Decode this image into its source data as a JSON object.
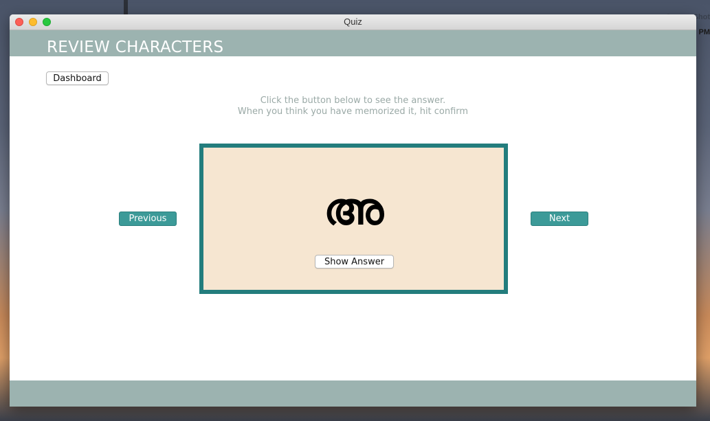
{
  "window": {
    "title": "Quiz"
  },
  "desktop": {
    "overlay_line1": "Screen Shot",
    "overlay_line2": "PM"
  },
  "header": {
    "title": "REVIEW CHARACTERS"
  },
  "toolbar": {
    "dashboard_label": "Dashboard"
  },
  "instructions": {
    "line1": "Click the button below to see the answer.",
    "line2": "When you think you have memorized it, hit confirm"
  },
  "navigation": {
    "previous_label": "Previous",
    "next_label": "Next"
  },
  "card": {
    "character": "അ",
    "show_answer_label": "Show Answer"
  },
  "colors": {
    "accent": "#3c9a98",
    "card_border": "#237d7d",
    "card_background": "#f6e6d1",
    "header_band": "#9cb3b0",
    "instruction_text": "#9aa9a6"
  },
  "icons": {
    "close": "close-icon",
    "minimize": "minimize-icon",
    "zoom": "zoom-icon"
  }
}
